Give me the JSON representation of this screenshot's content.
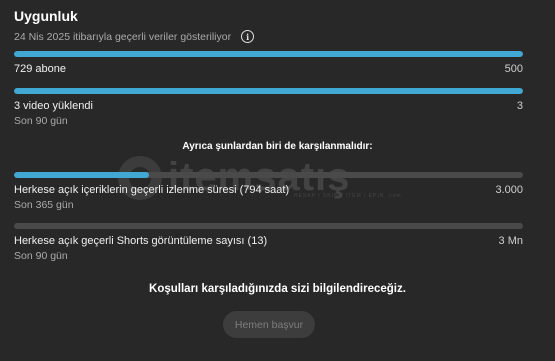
{
  "header": {
    "title": "Uygunluk",
    "subtitle": "24 Nis 2025 itibarıyla geçerli veriler gösteriliyor",
    "info_icon": "info-icon"
  },
  "metrics_required": [
    {
      "label": "729 abone",
      "target": "500",
      "period": "",
      "progress": 1.0
    },
    {
      "label": "3 video yüklendi",
      "target": "3",
      "period": "Son 90 gün",
      "progress": 1.0
    }
  ],
  "or_heading": "Ayrıca şunlardan biri de karşılanmalıdır:",
  "metrics_optional": [
    {
      "label": "Herkese açık içeriklerin geçerli izlenme süresi (794 saat)",
      "target": "3.000",
      "period": "Son 365 gün",
      "progress": 0.265
    },
    {
      "label": "Herkese açık geçerli Shorts görüntüleme sayısı (13)",
      "target": "3 Mn",
      "period": "Son 90 gün",
      "progress": 0.0
    }
  ],
  "notify_text": "Koşulları karşıladığınızda sizi bilgilendireceğiz.",
  "apply_button": "Hemen başvur",
  "watermark": {
    "text": "itemsatış",
    "domain": ".com",
    "tagline": "HESAP | SKIN | ITEM | EPIN"
  },
  "colors": {
    "background": "#282828",
    "progress_fill": "#41a8d4",
    "progress_track": "#4a4a4a"
  }
}
